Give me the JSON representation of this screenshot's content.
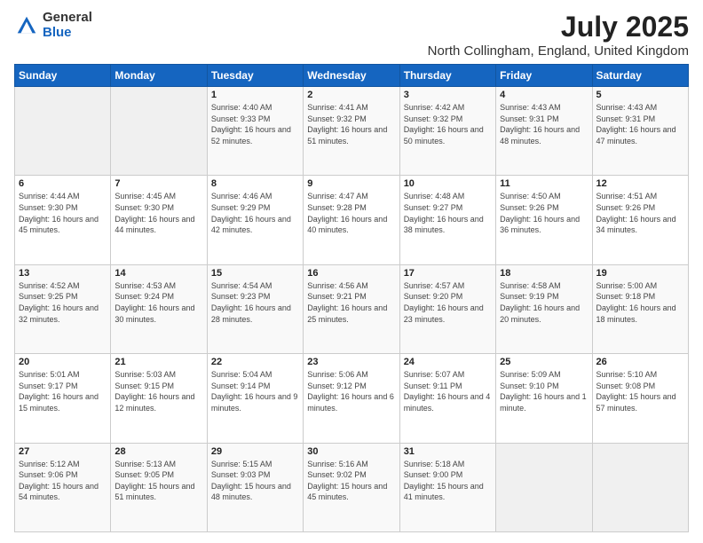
{
  "header": {
    "logo_general": "General",
    "logo_blue": "Blue",
    "title": "July 2025",
    "subtitle": "North Collingham, England, United Kingdom"
  },
  "weekdays": [
    "Sunday",
    "Monday",
    "Tuesday",
    "Wednesday",
    "Thursday",
    "Friday",
    "Saturday"
  ],
  "weeks": [
    [
      {
        "day": "",
        "info": ""
      },
      {
        "day": "",
        "info": ""
      },
      {
        "day": "1",
        "info": "Sunrise: 4:40 AM\nSunset: 9:33 PM\nDaylight: 16 hours and 52 minutes."
      },
      {
        "day": "2",
        "info": "Sunrise: 4:41 AM\nSunset: 9:32 PM\nDaylight: 16 hours and 51 minutes."
      },
      {
        "day": "3",
        "info": "Sunrise: 4:42 AM\nSunset: 9:32 PM\nDaylight: 16 hours and 50 minutes."
      },
      {
        "day": "4",
        "info": "Sunrise: 4:43 AM\nSunset: 9:31 PM\nDaylight: 16 hours and 48 minutes."
      },
      {
        "day": "5",
        "info": "Sunrise: 4:43 AM\nSunset: 9:31 PM\nDaylight: 16 hours and 47 minutes."
      }
    ],
    [
      {
        "day": "6",
        "info": "Sunrise: 4:44 AM\nSunset: 9:30 PM\nDaylight: 16 hours and 45 minutes."
      },
      {
        "day": "7",
        "info": "Sunrise: 4:45 AM\nSunset: 9:30 PM\nDaylight: 16 hours and 44 minutes."
      },
      {
        "day": "8",
        "info": "Sunrise: 4:46 AM\nSunset: 9:29 PM\nDaylight: 16 hours and 42 minutes."
      },
      {
        "day": "9",
        "info": "Sunrise: 4:47 AM\nSunset: 9:28 PM\nDaylight: 16 hours and 40 minutes."
      },
      {
        "day": "10",
        "info": "Sunrise: 4:48 AM\nSunset: 9:27 PM\nDaylight: 16 hours and 38 minutes."
      },
      {
        "day": "11",
        "info": "Sunrise: 4:50 AM\nSunset: 9:26 PM\nDaylight: 16 hours and 36 minutes."
      },
      {
        "day": "12",
        "info": "Sunrise: 4:51 AM\nSunset: 9:26 PM\nDaylight: 16 hours and 34 minutes."
      }
    ],
    [
      {
        "day": "13",
        "info": "Sunrise: 4:52 AM\nSunset: 9:25 PM\nDaylight: 16 hours and 32 minutes."
      },
      {
        "day": "14",
        "info": "Sunrise: 4:53 AM\nSunset: 9:24 PM\nDaylight: 16 hours and 30 minutes."
      },
      {
        "day": "15",
        "info": "Sunrise: 4:54 AM\nSunset: 9:23 PM\nDaylight: 16 hours and 28 minutes."
      },
      {
        "day": "16",
        "info": "Sunrise: 4:56 AM\nSunset: 9:21 PM\nDaylight: 16 hours and 25 minutes."
      },
      {
        "day": "17",
        "info": "Sunrise: 4:57 AM\nSunset: 9:20 PM\nDaylight: 16 hours and 23 minutes."
      },
      {
        "day": "18",
        "info": "Sunrise: 4:58 AM\nSunset: 9:19 PM\nDaylight: 16 hours and 20 minutes."
      },
      {
        "day": "19",
        "info": "Sunrise: 5:00 AM\nSunset: 9:18 PM\nDaylight: 16 hours and 18 minutes."
      }
    ],
    [
      {
        "day": "20",
        "info": "Sunrise: 5:01 AM\nSunset: 9:17 PM\nDaylight: 16 hours and 15 minutes."
      },
      {
        "day": "21",
        "info": "Sunrise: 5:03 AM\nSunset: 9:15 PM\nDaylight: 16 hours and 12 minutes."
      },
      {
        "day": "22",
        "info": "Sunrise: 5:04 AM\nSunset: 9:14 PM\nDaylight: 16 hours and 9 minutes."
      },
      {
        "day": "23",
        "info": "Sunrise: 5:06 AM\nSunset: 9:12 PM\nDaylight: 16 hours and 6 minutes."
      },
      {
        "day": "24",
        "info": "Sunrise: 5:07 AM\nSunset: 9:11 PM\nDaylight: 16 hours and 4 minutes."
      },
      {
        "day": "25",
        "info": "Sunrise: 5:09 AM\nSunset: 9:10 PM\nDaylight: 16 hours and 1 minute."
      },
      {
        "day": "26",
        "info": "Sunrise: 5:10 AM\nSunset: 9:08 PM\nDaylight: 15 hours and 57 minutes."
      }
    ],
    [
      {
        "day": "27",
        "info": "Sunrise: 5:12 AM\nSunset: 9:06 PM\nDaylight: 15 hours and 54 minutes."
      },
      {
        "day": "28",
        "info": "Sunrise: 5:13 AM\nSunset: 9:05 PM\nDaylight: 15 hours and 51 minutes."
      },
      {
        "day": "29",
        "info": "Sunrise: 5:15 AM\nSunset: 9:03 PM\nDaylight: 15 hours and 48 minutes."
      },
      {
        "day": "30",
        "info": "Sunrise: 5:16 AM\nSunset: 9:02 PM\nDaylight: 15 hours and 45 minutes."
      },
      {
        "day": "31",
        "info": "Sunrise: 5:18 AM\nSunset: 9:00 PM\nDaylight: 15 hours and 41 minutes."
      },
      {
        "day": "",
        "info": ""
      },
      {
        "day": "",
        "info": ""
      }
    ]
  ]
}
